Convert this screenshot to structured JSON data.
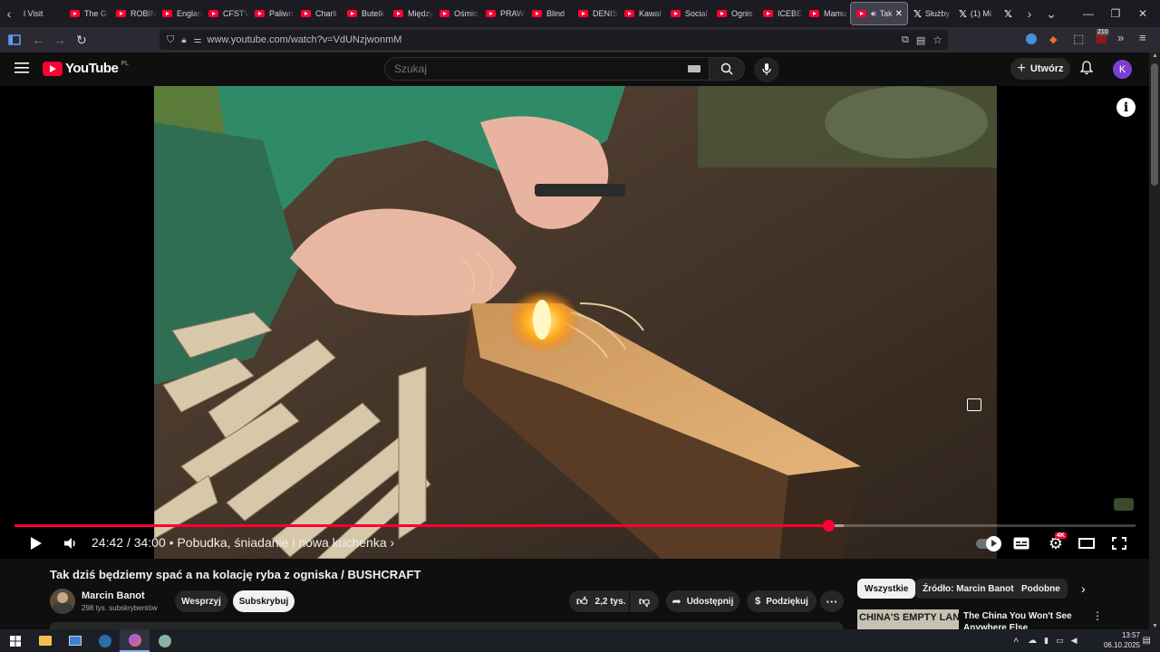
{
  "browser": {
    "tabs": [
      {
        "label": "l Visit",
        "type": "plain"
      },
      {
        "label": "The G",
        "type": "yt"
      },
      {
        "label": "ROBIN",
        "type": "yt"
      },
      {
        "label": "Englan",
        "type": "yt"
      },
      {
        "label": "CFSTV",
        "type": "yt"
      },
      {
        "label": "Paliwo",
        "type": "yt"
      },
      {
        "label": "Charli",
        "type": "yt"
      },
      {
        "label": "Butelk",
        "type": "yt"
      },
      {
        "label": "Między",
        "type": "yt"
      },
      {
        "label": "Ośmio",
        "type": "yt"
      },
      {
        "label": "PRAW",
        "type": "yt"
      },
      {
        "label": "Blind",
        "type": "yt"
      },
      {
        "label": "DENIS",
        "type": "yt"
      },
      {
        "label": "Kawał",
        "type": "yt"
      },
      {
        "label": "Social",
        "type": "yt"
      },
      {
        "label": "Ognis",
        "type": "yt"
      },
      {
        "label": "ICEBE",
        "type": "yt"
      },
      {
        "label": "Mamu",
        "type": "yt"
      },
      {
        "label": "Tak",
        "type": "active"
      },
      {
        "label": "Służby",
        "type": "x"
      },
      {
        "label": "(1) Mi",
        "type": "x"
      },
      {
        "label": "",
        "type": "x"
      }
    ],
    "url": "www.youtube.com/watch?v=VdUNzjwonmM",
    "extension_badge": "210"
  },
  "youtube": {
    "logo_text": "YouTube",
    "region": "PL",
    "search_placeholder": "Szukaj",
    "create_label": "Utwórz",
    "avatar_letter": "K"
  },
  "player": {
    "current_time": "24:42",
    "duration": "34:00",
    "chapter": "Pobudka, śniadanie i nowa kuchenka",
    "progress_fraction": 0.726,
    "buffered_fraction": 0.74,
    "quality_badge": "4K"
  },
  "video": {
    "title": "Tak dziś będziemy spać a na kolację ryba z ogniska / BUSHCRAFT",
    "channel": "Marcin Banot",
    "subscribers": "298 tys. subskrybentów",
    "support_label": "Wesprzyj",
    "subscribe_label": "Subskrybuj",
    "likes": "2,2 tys.",
    "share_label": "Udostępnij",
    "thanks_label": "Podziękuj"
  },
  "sidebar": {
    "chips": [
      "Wszystkie",
      "Źródło: Marcin Banot",
      "Podobne"
    ],
    "first_video_title": "The China You Won't See Anywhere Else",
    "first_video_thumb_text": "CHINA'S EMPTY LANDS"
  },
  "taskbar": {
    "time": "13:57",
    "date": "06.10.2025"
  },
  "colors": {
    "accent": "#ff0033",
    "background": "#0f0f0f"
  }
}
